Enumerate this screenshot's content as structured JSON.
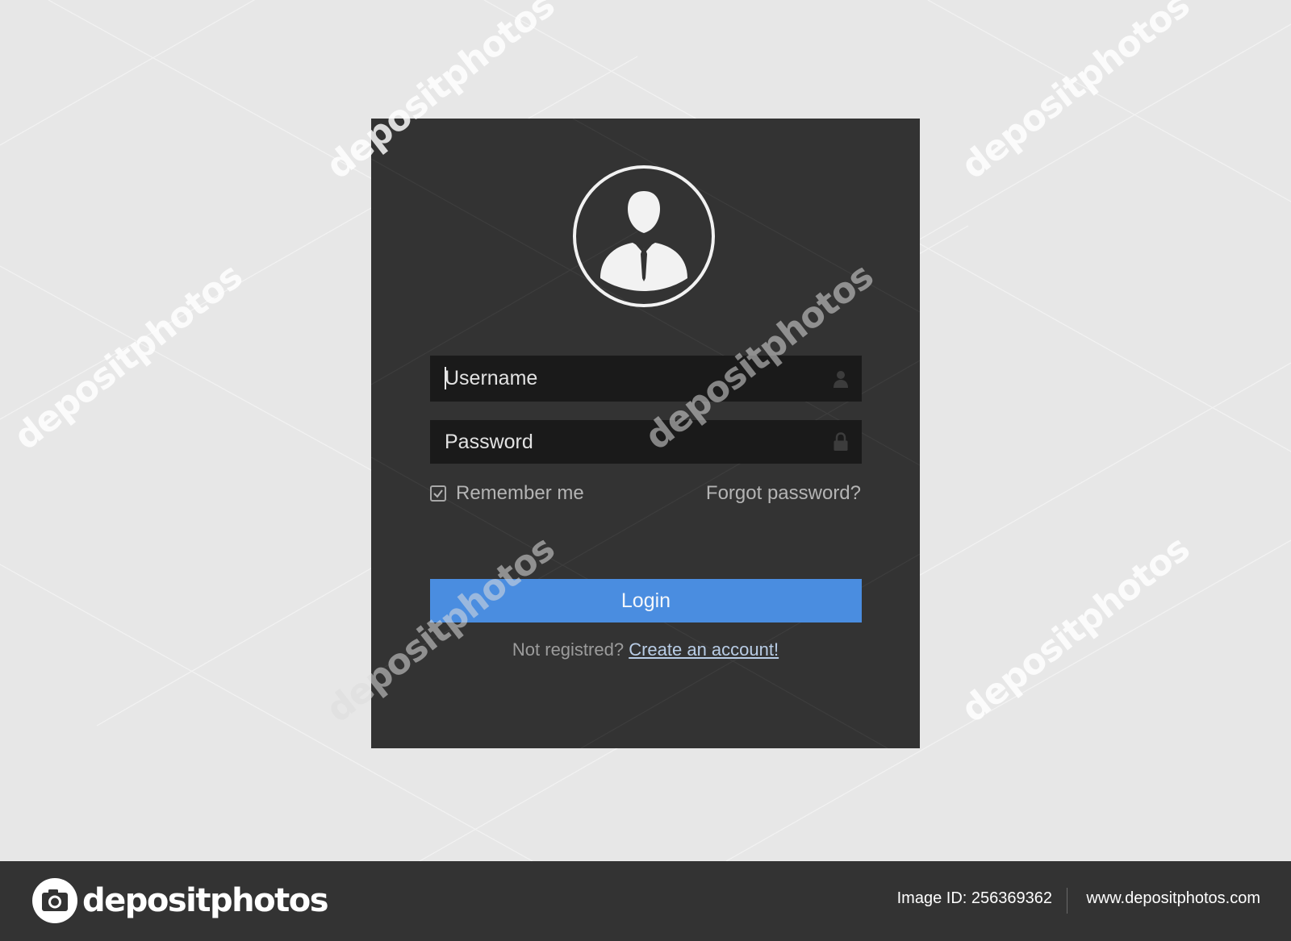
{
  "login": {
    "username_placeholder": "Username",
    "password_placeholder": "Password",
    "remember_label": "Remember me",
    "remember_checked": true,
    "forgot_label": "Forgot password?",
    "login_label": "Login",
    "not_registered": "Not registred?",
    "create_account": "Create an account!"
  },
  "icons": {
    "avatar": "user-avatar-icon",
    "username": "user-icon",
    "password": "lock-icon",
    "remember": "checkmark-icon"
  },
  "footer": {
    "brand": "depositphotos",
    "image_id": "Image ID: 256369362",
    "site": "www.depositphotos.com"
  },
  "watermark": {
    "text": "depositphotos"
  },
  "colors": {
    "page_bg": "#e7e7e7",
    "card_bg": "#333333",
    "field_bg": "#1a1a1a",
    "accent": "#4a8de0",
    "footer_bg": "#333333"
  }
}
